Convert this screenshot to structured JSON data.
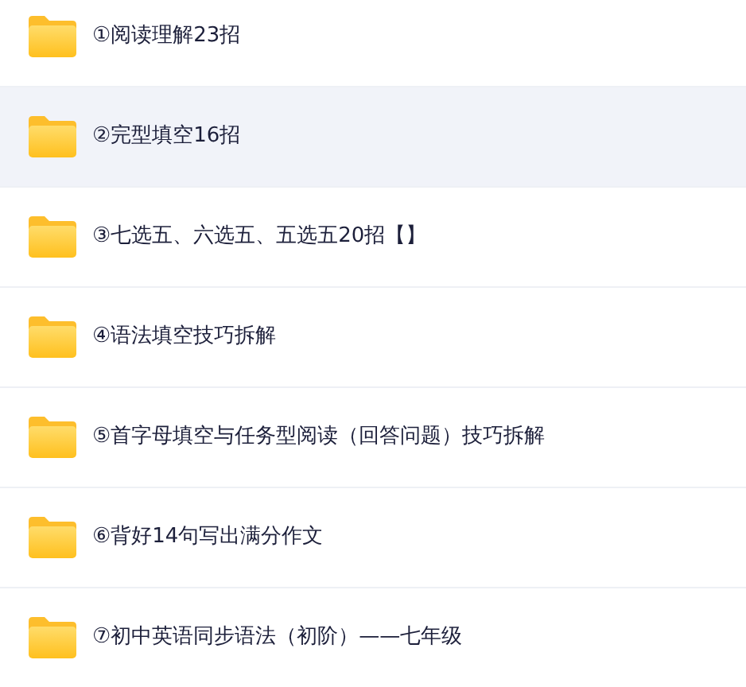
{
  "files": [
    {
      "name": "①阅读理解23招",
      "selected": false
    },
    {
      "name": "②完型填空16招",
      "selected": true
    },
    {
      "name": "③七选五、六选五、五选五20招【】",
      "selected": false
    },
    {
      "name": "④语法填空技巧拆解",
      "selected": false
    },
    {
      "name": "⑤首字母填空与任务型阅读（回答问题）技巧拆解",
      "selected": false
    },
    {
      "name": "⑥背好14句写出满分作文",
      "selected": false
    },
    {
      "name": "⑦初中英语同步语法（初阶）——七年级",
      "selected": false
    }
  ]
}
